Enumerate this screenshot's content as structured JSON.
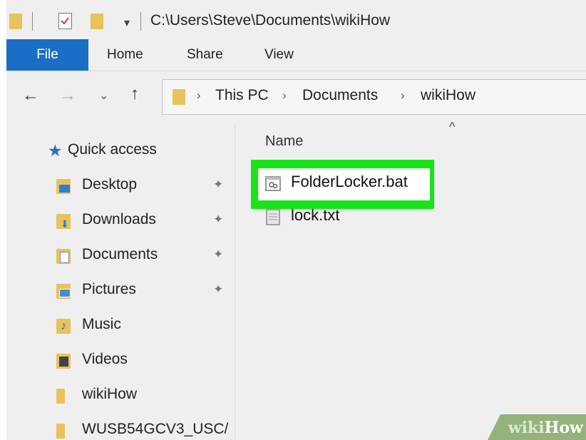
{
  "titlebar": {
    "path": "C:\\Users\\Steve\\Documents\\wikiHow",
    "qa_arrow": "▾"
  },
  "ribbon": {
    "tabs": [
      "File",
      "Home",
      "Share",
      "View"
    ]
  },
  "address": {
    "breadcrumb": [
      "This PC",
      "Documents",
      "wikiHow"
    ],
    "separator": "›"
  },
  "nav": {
    "quick_access": "Quick access",
    "items": [
      {
        "label": "Desktop",
        "pinned": true,
        "icon": "desktop-folder-icon",
        "color": "#2a7fd4"
      },
      {
        "label": "Downloads",
        "pinned": true,
        "icon": "downloads-folder-icon",
        "color": "#2a7fd4"
      },
      {
        "label": "Documents",
        "pinned": true,
        "icon": "documents-folder-icon",
        "color": "#9a9a9a"
      },
      {
        "label": "Pictures",
        "pinned": true,
        "icon": "pictures-folder-icon",
        "color": "#4a8ed0"
      },
      {
        "label": "Music",
        "pinned": false,
        "icon": "music-folder-icon",
        "color": "#2a6fc4"
      },
      {
        "label": "Videos",
        "pinned": false,
        "icon": "videos-folder-icon",
        "color": "#444444"
      },
      {
        "label": "wikiHow",
        "pinned": false,
        "icon": "folder-icon",
        "color": "#e8c25a"
      },
      {
        "label": "WUSB54GCV3_USC/",
        "pinned": false,
        "icon": "folder-icon",
        "color": "#e8c25a"
      }
    ],
    "pin_glyph": "📌"
  },
  "content": {
    "column_header": "Name",
    "sort_indicator": "^",
    "files": [
      {
        "name": "FolderLocker.bat",
        "icon": "batch-file-icon",
        "highlighted": true
      },
      {
        "name": "lock.txt",
        "icon": "text-file-icon",
        "highlighted": false
      }
    ]
  },
  "watermark": {
    "part1": "wiki",
    "part2": "How"
  },
  "colors": {
    "accent": "#1a6fc4",
    "highlight": "#19e319",
    "folder": "#e8c25a"
  }
}
